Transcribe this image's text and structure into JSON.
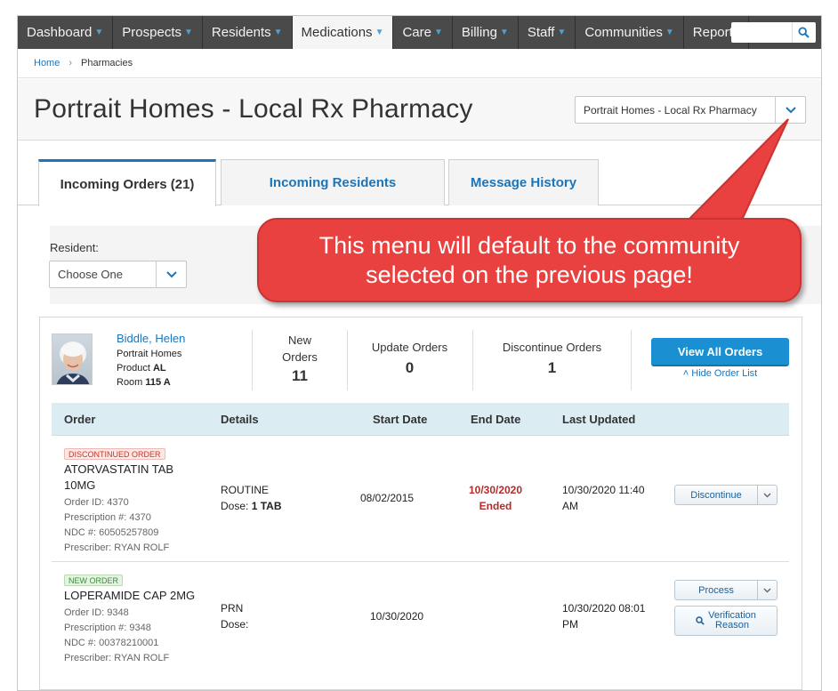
{
  "nav": {
    "items": [
      {
        "label": "Dashboard",
        "caret": true
      },
      {
        "label": "Prospects",
        "caret": true
      },
      {
        "label": "Residents",
        "caret": true
      },
      {
        "label": "Medications",
        "caret": true
      },
      {
        "label": "Care",
        "caret": true
      },
      {
        "label": "Billing",
        "caret": true
      },
      {
        "label": "Staff",
        "caret": true
      },
      {
        "label": "Communities",
        "caret": true
      },
      {
        "label": "Reports",
        "caret": false
      }
    ],
    "active": "Medications",
    "search_value": ""
  },
  "breadcrumb": {
    "home": "Home",
    "current": "Pharmacies"
  },
  "header": {
    "title": "Portrait Homes - Local Rx Pharmacy",
    "community_select_value": "Portrait Homes - Local Rx Pharmacy"
  },
  "tabs": [
    {
      "label": "Incoming Orders (21)",
      "active": true
    },
    {
      "label": "Incoming Residents",
      "active": false
    },
    {
      "label": "Message History",
      "active": false
    }
  ],
  "filter": {
    "resident_label": "Resident:",
    "resident_value": "Choose One"
  },
  "resident": {
    "name": "Biddle, Helen",
    "community": "Portrait Homes",
    "product_label": "Product",
    "product": "AL",
    "room_label": "Room",
    "room": "115 A"
  },
  "stats": {
    "new_orders_label_1": "New",
    "new_orders_label_2": "Orders",
    "new_orders": "11",
    "update_orders_label": "Update Orders",
    "update_orders": "0",
    "discontinue_orders_label": "Discontinue Orders",
    "discontinue_orders": "1"
  },
  "actions": {
    "view_all": "View All Orders",
    "hide_list": "Hide Order List"
  },
  "table": {
    "headers": {
      "order": "Order",
      "details": "Details",
      "start": "Start Date",
      "end": "End Date",
      "updated": "Last Updated"
    },
    "rows": [
      {
        "badge": "DISCONTINUED ORDER",
        "drug_line1": "ATORVASTATIN TAB",
        "drug_line2": "10MG",
        "order_id": "Order ID: 4370",
        "prescription": "Prescription #: 4370",
        "ndc": "NDC #: 60505257809",
        "prescriber": "Prescriber: RYAN ROLF",
        "frequency": "ROUTINE",
        "dose_label": "Dose:",
        "dose": "1 TAB",
        "start": "08/02/2015",
        "end": "10/30/2020",
        "end_status": "Ended",
        "updated_line1": "10/30/2020 11:40",
        "updated_line2": "AM",
        "action": "Discontinue"
      },
      {
        "badge": "NEW ORDER",
        "drug_line1": "LOPERAMIDE CAP 2MG",
        "order_id": "Order ID: 9348",
        "prescription": "Prescription #: 9348",
        "ndc": "NDC #: 00378210001",
        "prescriber": "Prescriber: RYAN ROLF",
        "frequency": "PRN",
        "dose_label": "Dose:",
        "dose": "",
        "start": "10/30/2020",
        "updated_line1": "10/30/2020 08:01",
        "updated_line2": "PM",
        "action": "Process",
        "secondary_action_line1": "Verification",
        "secondary_action_line2": "Reason"
      }
    ]
  },
  "callout": {
    "line1": "This menu will default to the community",
    "line2": "selected on the previous page!"
  },
  "colors": {
    "accent": "#1b75bb",
    "callout": "#e8413f",
    "nav": "#4a4a4a",
    "button": "#1a8fd1"
  }
}
